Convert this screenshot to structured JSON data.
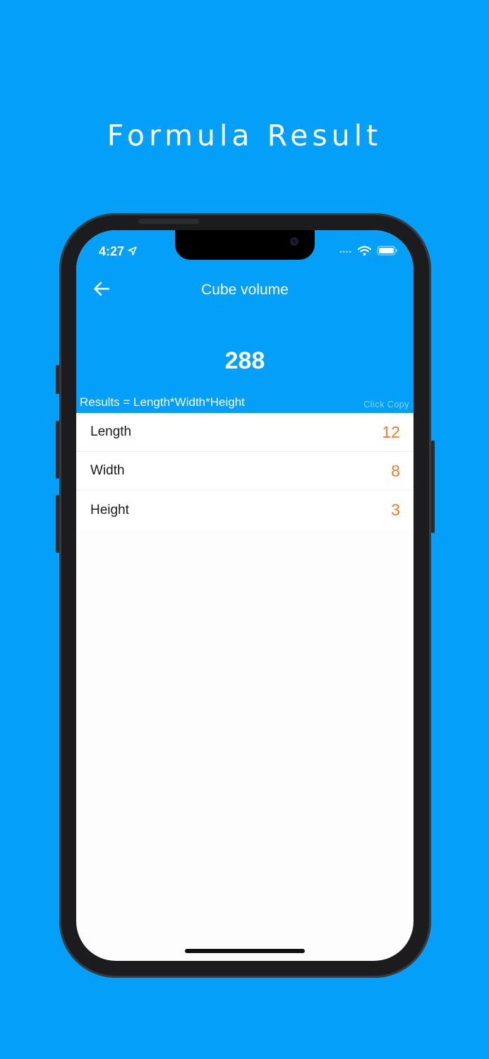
{
  "headline": "Formula Result",
  "status_bar": {
    "time": "4:27",
    "location_icon": "location-arrow-icon",
    "wifi_icon": "wifi-icon",
    "battery_icon": "battery-icon"
  },
  "nav": {
    "back_icon": "arrow-left-icon",
    "title": "Cube volume"
  },
  "result": {
    "value": "288",
    "formula": "Results = Length*Width*Height",
    "copy_label": "Click Copy"
  },
  "inputs": [
    {
      "label": "Length",
      "value": "12"
    },
    {
      "label": "Width",
      "value": "8"
    },
    {
      "label": "Height",
      "value": "3"
    }
  ],
  "colors": {
    "brand_blue": "#039ff8",
    "value_orange": "#f07b2c"
  }
}
